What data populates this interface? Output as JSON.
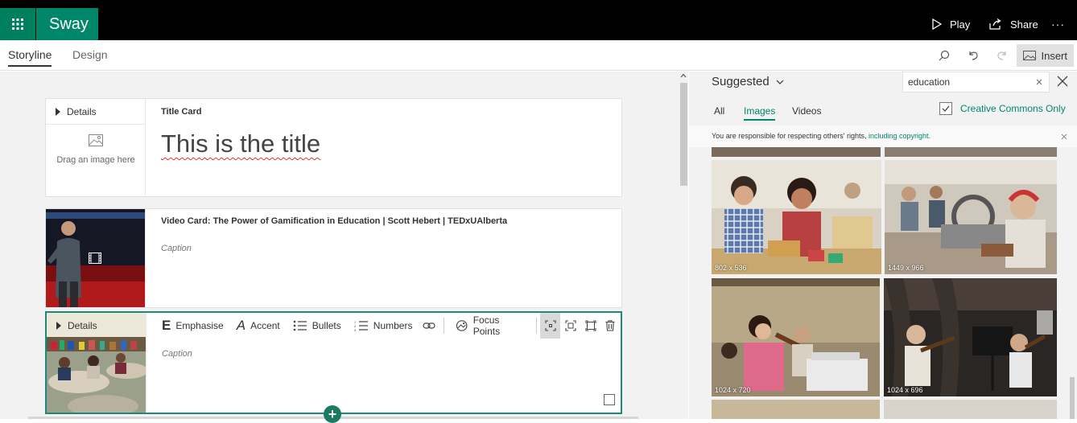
{
  "app": {
    "name": "Sway"
  },
  "header": {
    "play_label": "Play",
    "share_label": "Share",
    "more_label": "···"
  },
  "tabs": {
    "storyline": "Storyline",
    "design": "Design"
  },
  "toolbar": {
    "insert_label": "Insert"
  },
  "cards": {
    "title_card": {
      "details_label": "Details",
      "card_type": "Title Card",
      "title": "This is the title",
      "image_placeholder": "Drag an image here"
    },
    "video_card": {
      "title": "Video Card: The Power of Gamification in Education | Scott Hebert | TEDxUAlberta",
      "caption_placeholder": "Caption"
    },
    "image_card": {
      "details_label": "Details",
      "caption_placeholder": "Caption",
      "format": {
        "emphasise": "Emphasise",
        "accent": "Accent",
        "bullets": "Bullets",
        "numbers": "Numbers",
        "focus_points": "Focus Points"
      }
    }
  },
  "panel": {
    "source_label": "Suggested",
    "search_value": "education",
    "filters": {
      "all": "All",
      "images": "Images",
      "videos": "Videos"
    },
    "creative_commons_label": "Creative Commons Only",
    "notice_text": "You are responsible for respecting others' rights, ",
    "notice_link": "including copyright.",
    "images": [
      {
        "dims": "802 x 536"
      },
      {
        "dims": "1449 x 966"
      },
      {
        "dims": "1024 x 720"
      },
      {
        "dims": "1024 x 696"
      }
    ]
  },
  "colors": {
    "accent": "#00866a",
    "topbar": "#000000"
  }
}
